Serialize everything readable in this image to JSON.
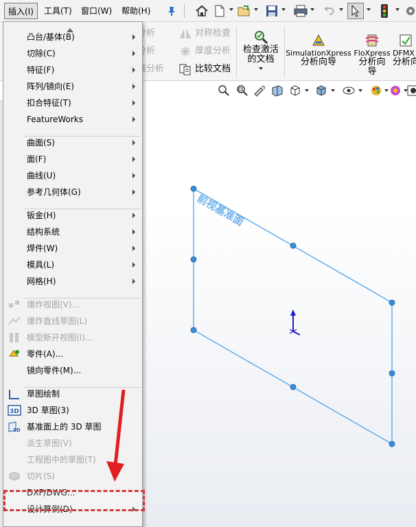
{
  "menubar": {
    "items": [
      {
        "label": "插入(I)",
        "active": true
      },
      {
        "label": "工具(T)"
      },
      {
        "label": "窗口(W)"
      },
      {
        "label": "帮助(H)"
      }
    ],
    "icons": [
      "pin-icon",
      "home-icon",
      "new-file-icon",
      "open-file-icon",
      "save-icon",
      "print-icon",
      "undo-icon",
      "select-cursor-icon",
      "traffic-light-icon"
    ]
  },
  "ribbon": {
    "small_tools": [
      {
        "label": "分析",
        "disabled": true
      },
      {
        "label": "分析",
        "disabled": true
      },
      {
        "label": "线分析",
        "disabled": true
      },
      {
        "label": "对称检查",
        "disabled": true
      },
      {
        "label": "厚度分析",
        "disabled": true
      },
      {
        "label": "比较文档",
        "disabled": false
      }
    ],
    "big_tools": [
      {
        "label_lines": [
          "检查激活",
          "的文档"
        ],
        "has_dropdown": true
      },
      {
        "label_lines": [
          "SimulationXpress",
          "分析向导"
        ]
      },
      {
        "label_lines": [
          "FloXpress",
          "分析向",
          "导"
        ]
      },
      {
        "label_lines": [
          "DFMX",
          "分析向"
        ]
      }
    ]
  },
  "viewport": {
    "plane_label": "前视基准面",
    "plane_color": "#5aa7ea",
    "axis_color": "#1a1ad0"
  },
  "dropdown": {
    "items": [
      {
        "label": "凸台/基体(B)",
        "submenu": true,
        "disabled": false
      },
      {
        "label": "切除(C)",
        "submenu": true,
        "disabled": false
      },
      {
        "label": "特征(F)",
        "submenu": true,
        "disabled": false
      },
      {
        "label": "阵列/镜向(E)",
        "submenu": true,
        "disabled": false
      },
      {
        "label": "扣合特征(T)",
        "submenu": true,
        "disabled": false
      },
      {
        "label": "FeatureWorks",
        "submenu": true,
        "disabled": false
      },
      {
        "label": "曲面(S)",
        "submenu": true,
        "disabled": false
      },
      {
        "label": "面(F)",
        "submenu": true,
        "disabled": false
      },
      {
        "label": "曲线(U)",
        "submenu": true,
        "disabled": false
      },
      {
        "label": "参考几何体(G)",
        "submenu": true,
        "disabled": false
      },
      {
        "label": "钣金(H)",
        "submenu": true,
        "disabled": false
      },
      {
        "label": "结构系统",
        "submenu": true,
        "disabled": false
      },
      {
        "label": "焊件(W)",
        "submenu": true,
        "disabled": false
      },
      {
        "label": "模具(L)",
        "submenu": true,
        "disabled": false
      },
      {
        "label": "网格(H)",
        "submenu": true,
        "disabled": false
      },
      {
        "label": "爆炸视图(V)...",
        "submenu": false,
        "disabled": true,
        "icon": "explode-view-icon"
      },
      {
        "label": "爆炸直线草图(L)",
        "submenu": false,
        "disabled": true,
        "icon": "explode-line-sketch-icon"
      },
      {
        "label": "模型断开视图(I)...",
        "submenu": false,
        "disabled": true,
        "icon": "broken-view-icon"
      },
      {
        "label": "零件(A)...",
        "submenu": false,
        "disabled": false,
        "icon": "part-icon"
      },
      {
        "label": "镜向零件(M)...",
        "submenu": false,
        "disabled": false
      },
      {
        "label": "草图绘制",
        "submenu": false,
        "disabled": false,
        "icon": "sketch-icon"
      },
      {
        "label": "3D 草图(3)",
        "submenu": false,
        "disabled": false,
        "icon": "3d-sketch-icon"
      },
      {
        "label": "基准面上的 3D 草图",
        "submenu": false,
        "disabled": false,
        "icon": "3d-sketch-on-plane-icon"
      },
      {
        "label": "派生草图(V)",
        "submenu": false,
        "disabled": true
      },
      {
        "label": "工程图中的草图(T)",
        "submenu": false,
        "disabled": true
      },
      {
        "label": "切片(S)",
        "submenu": false,
        "disabled": true,
        "icon": "slice-icon"
      },
      {
        "label": "DXF/DWG...",
        "submenu": false,
        "disabled": false,
        "highlighted": true
      },
      {
        "label": "设计算例(D)",
        "submenu": true,
        "disabled": false
      }
    ]
  },
  "annotation": {
    "arrow_color": "#e02020",
    "highlight_color": "#d23a3a"
  }
}
